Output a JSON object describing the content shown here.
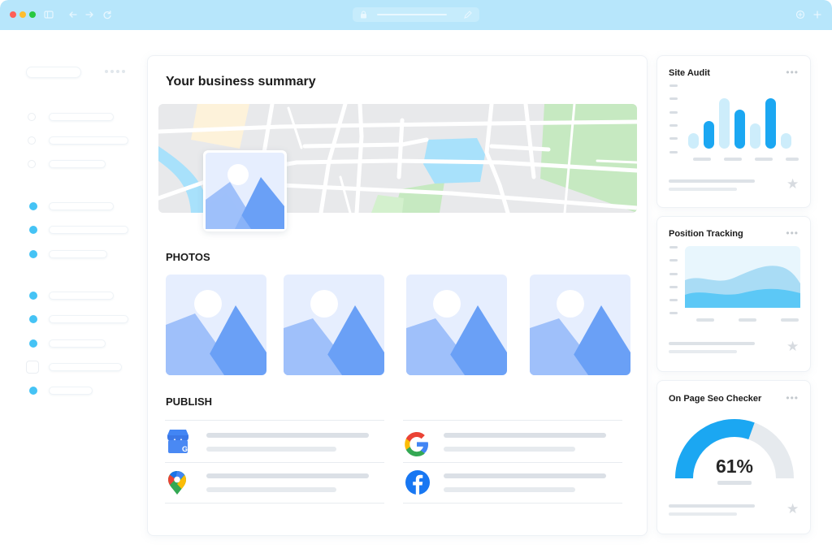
{
  "main": {
    "title": "Your business summary",
    "photos_heading": "PHOTOS",
    "publish_heading": "PUBLISH",
    "publish_targets": [
      "google-business-icon",
      "google-icon",
      "google-maps-icon",
      "facebook-icon"
    ]
  },
  "widgets": {
    "site_audit": {
      "title": "Site Audit",
      "more": "•••"
    },
    "position_tracking": {
      "title": "Position Tracking",
      "more": "•••"
    },
    "seo_checker": {
      "title": "On Page Seo Checker",
      "more": "•••",
      "score_label": "61%",
      "score": 0.61
    }
  },
  "colors": {
    "titlebar": "#b7e6fb",
    "accent": "#1ba7f2",
    "accent_light": "#cdedfb",
    "image_dark": "#6aa0f6",
    "image_light": "#9fc0fa",
    "image_bg": "#e6eefe"
  },
  "site_audit_chart": {
    "values": [
      0.3,
      0.55,
      1.0,
      0.78,
      0.5,
      1.0,
      0.3
    ],
    "highlighted": [
      false,
      true,
      false,
      true,
      false,
      true,
      false
    ]
  }
}
